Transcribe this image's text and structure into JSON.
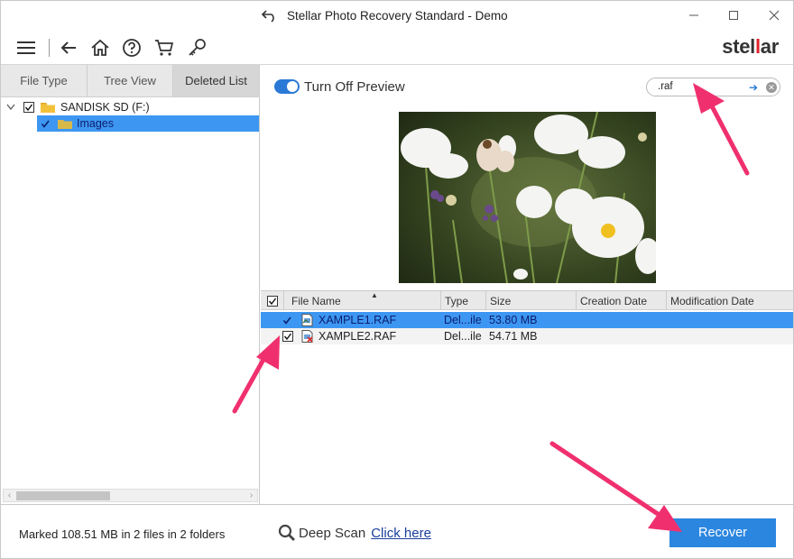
{
  "window": {
    "title": "Stellar Photo Recovery Standard - Demo",
    "icons": [
      "undo-icon",
      "minimize-icon",
      "maximize-icon",
      "close-icon"
    ]
  },
  "toolbar": {
    "icons": [
      "menu-icon",
      "back-arrow-icon",
      "home-icon",
      "help-icon",
      "cart-icon",
      "key-icon"
    ],
    "logo_prefix": "stel",
    "logo_accent": "l",
    "logo_suffix": "ar"
  },
  "left_pane": {
    "tabs": [
      {
        "label": "File Type"
      },
      {
        "label": "Tree View"
      },
      {
        "label": "Deleted List"
      }
    ],
    "active_tab": "Deleted List",
    "tree": [
      {
        "label": "SANDISK SD (F:)",
        "checked": true,
        "expanded": true
      },
      {
        "label": "Images",
        "checked": true,
        "selected": true
      }
    ]
  },
  "preview": {
    "toggle_label": "Turn Off Preview",
    "toggle_on": true,
    "search_value": ".raf"
  },
  "file_list": {
    "columns": [
      "File Name",
      "Type",
      "Size",
      "Creation Date",
      "Modification Date"
    ],
    "rows": [
      {
        "name": "XAMPLE1.RAF",
        "type": "Del...ile",
        "size": "53.80 MB",
        "created": "",
        "modified": "",
        "checked": true,
        "selected": true
      },
      {
        "name": "XAMPLE2.RAF",
        "type": "Del...ile",
        "size": "54.71 MB",
        "created": "",
        "modified": "",
        "checked": true,
        "selected": false
      }
    ]
  },
  "status": {
    "marked_text": "Marked 108.51 MB in 2 files in 2 folders",
    "deep_scan_label": "Deep Scan",
    "deep_scan_link": "Click here",
    "recover_label": "Recover"
  },
  "colors": {
    "accent": "#2b86e0",
    "selection": "#3d97f2",
    "logo_red": "#e0232a",
    "annotation_arrow": "#f0306e"
  }
}
